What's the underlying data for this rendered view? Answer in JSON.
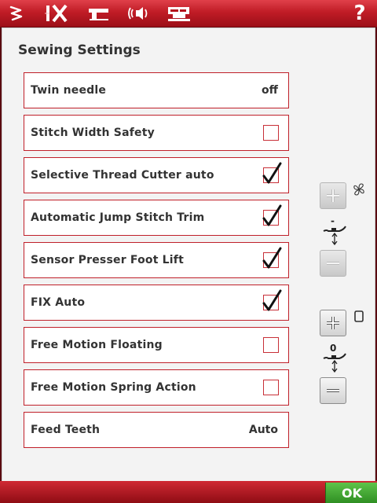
{
  "page": {
    "title": "Sewing Settings"
  },
  "topbar": {
    "items": [
      {
        "name": "stitch-menu-icon"
      },
      {
        "name": "fix-icon",
        "active": true
      },
      {
        "name": "sewing-machine-settings-icon"
      },
      {
        "name": "sound-settings-icon"
      },
      {
        "name": "machine-info-icon"
      }
    ],
    "help_label": "?"
  },
  "settings": [
    {
      "label": "Twin needle",
      "type": "value",
      "value": "off"
    },
    {
      "label": "Stitch Width Safety",
      "type": "checkbox",
      "checked": false
    },
    {
      "label": "Selective Thread Cutter auto",
      "type": "checkbox",
      "checked": true
    },
    {
      "label": "Automatic Jump Stitch Trim",
      "type": "checkbox",
      "checked": true
    },
    {
      "label": "Sensor Presser Foot Lift",
      "type": "checkbox",
      "checked": true
    },
    {
      "label": "FIX Auto",
      "type": "checkbox",
      "checked": true
    },
    {
      "label": "Free Motion Floating",
      "type": "checkbox",
      "checked": false
    },
    {
      "label": "Free Motion Spring Action",
      "type": "checkbox",
      "checked": false
    },
    {
      "label": "Feed Teeth",
      "type": "value",
      "value": "Auto"
    }
  ],
  "side_controls": {
    "floating_value": "-",
    "spring_value": "0"
  },
  "footer": {
    "ok_label": "OK"
  },
  "colors": {
    "accent_red": "#c0202a",
    "ok_green": "#3fa82f",
    "panel_bg": "#f3f3f3"
  }
}
